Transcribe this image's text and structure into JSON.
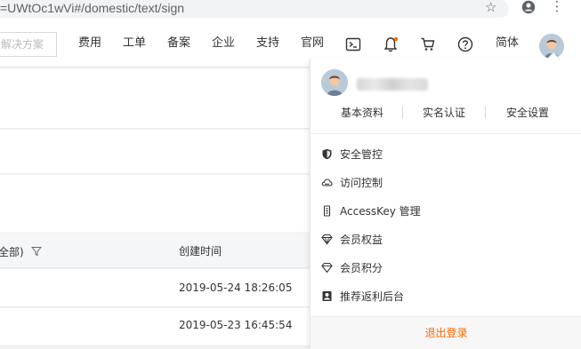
{
  "browser": {
    "url_visible": "=UWtOc1wVi#/domestic/text/sign",
    "star_icon": "star-icon",
    "account_icon": "account-circle-icon",
    "menu_icon": "kebab-menu-icon"
  },
  "topnav": {
    "search_placeholder": "解决方案",
    "items": [
      {
        "label": "费用"
      },
      {
        "label": "工单"
      },
      {
        "label": "备案"
      },
      {
        "label": "企业"
      },
      {
        "label": "支持"
      },
      {
        "label": "官网"
      }
    ],
    "icons": [
      "terminal-icon",
      "bell-icon",
      "cart-icon",
      "help-icon"
    ],
    "language": "简体",
    "notification_dot_color": "#ff6a00"
  },
  "table": {
    "header_status": "全部)",
    "header_created": "创建时间",
    "rows": [
      {
        "created": "2019-05-24 18:26:05"
      },
      {
        "created": "2019-05-23 16:45:54"
      }
    ]
  },
  "account_menu": {
    "tabs": [
      {
        "label": "基本资料"
      },
      {
        "label": "实名认证"
      },
      {
        "label": "安全设置"
      }
    ],
    "items": [
      {
        "label": "安全管控",
        "icon": "shield-icon"
      },
      {
        "label": "访问控制",
        "icon": "cloud-icon"
      },
      {
        "label": "AccessKey 管理",
        "icon": "key-icon"
      },
      {
        "label": "会员权益",
        "icon": "diamond-icon"
      },
      {
        "label": "会员积分",
        "icon": "diamond-outline-icon"
      },
      {
        "label": "推荐返利后台",
        "icon": "portrait-icon"
      }
    ],
    "logout": "退出登录",
    "accent_color": "#ff6a00"
  }
}
